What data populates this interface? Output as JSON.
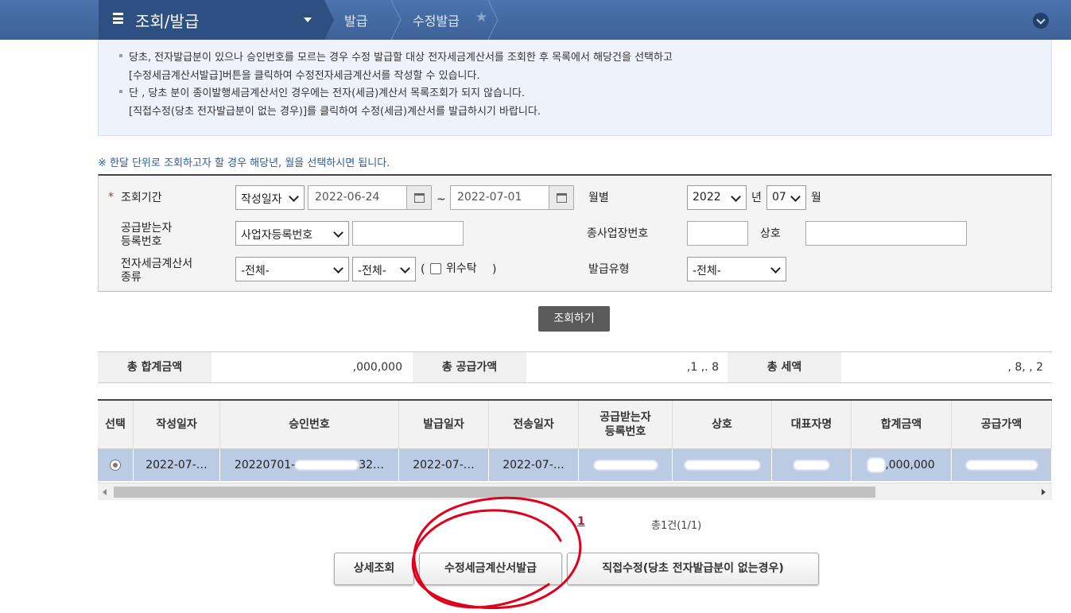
{
  "nav": {
    "menu_title": "조회/발급",
    "breadcrumb": [
      "발급",
      "수정발급"
    ]
  },
  "notice": {
    "lines": [
      "당초, 전자발급분이 있으나 승인번호를 모르는 경우 수정 발급할 대상 전자세금계산서를 조회한 후 목록에서 해당건을 선택하고",
      "[수정세금계산서발급]버튼을 클릭하여 수정전자세금계산서를 작성할 수 있습니다.",
      "단 , 당초 분이 종이발행세금계산서인 경우에는 전자(세금)계산서 목록조회가 되지 않습니다.",
      "[직접수정(당초 전자발급분이 없는 경우)]를 클릭하여 수정(세금)계산서를 발급하시기 바랍니다."
    ]
  },
  "hint": "※ 한달 단위로 조회하고자 할 경우 해당년, 월을 선택하시면 됩니다.",
  "form": {
    "period_label": "조회기간",
    "date_type": "작성일자",
    "date_from": "2022-06-24",
    "tilde": "~",
    "date_to": "2022-07-01",
    "monthly_label": "월별",
    "year": "2022",
    "year_unit": "년",
    "month": "07",
    "month_unit": "월",
    "receiver_label_1": "공급받는자",
    "receiver_label_2": "등록번호",
    "receiver_type": "사업자등록번호",
    "receiver_value": "",
    "branch_label": "종사업장번호",
    "branch_value": "",
    "company_label": "상호",
    "company_value": "",
    "kind_label_1": "전자세금계산서",
    "kind_label_2": "종류",
    "kind_select_1": "-전체-",
    "kind_select_2": "-전체-",
    "paren_open": "(",
    "consign_label": "위수탁",
    "paren_close": ")",
    "issue_type_label": "발급유형",
    "issue_type": "-전체-",
    "search_button": "조회하기"
  },
  "summary": {
    "total_label": "총 합계금액",
    "total_value": ",000,000",
    "supply_label": "총 공급가액",
    "supply_value": ",1  ,.  8",
    "tax_label": "총 세액",
    "tax_value": ",    8, ,  2"
  },
  "table": {
    "headers": [
      "선택",
      "작성일자",
      "승인번호",
      "발급일자",
      "전송일자",
      "공급받는자\n등록번호",
      "상호",
      "대표자명",
      "합계금액",
      "공급가액"
    ],
    "rows": [
      {
        "write_date": "2022-07-…",
        "approval_no": "20220701-",
        "approval_tail": "32…",
        "issue_date": "2022-07-…",
        "send_date": "2022-07-…",
        "total": ",000,000"
      }
    ]
  },
  "pagination": {
    "current": "1",
    "total_text": "총1건(1/1)"
  },
  "buttons": {
    "detail": "상세조회",
    "amend_issue": "수정세금계산서발급",
    "direct_amend": "직접수정(당초 전자발급분이 없는경우)"
  },
  "colors": {
    "header_blue": "#3d6298",
    "row_selected": "#bccbe4",
    "annotation_red": "#e0001c",
    "link_red": "#a3223a"
  }
}
